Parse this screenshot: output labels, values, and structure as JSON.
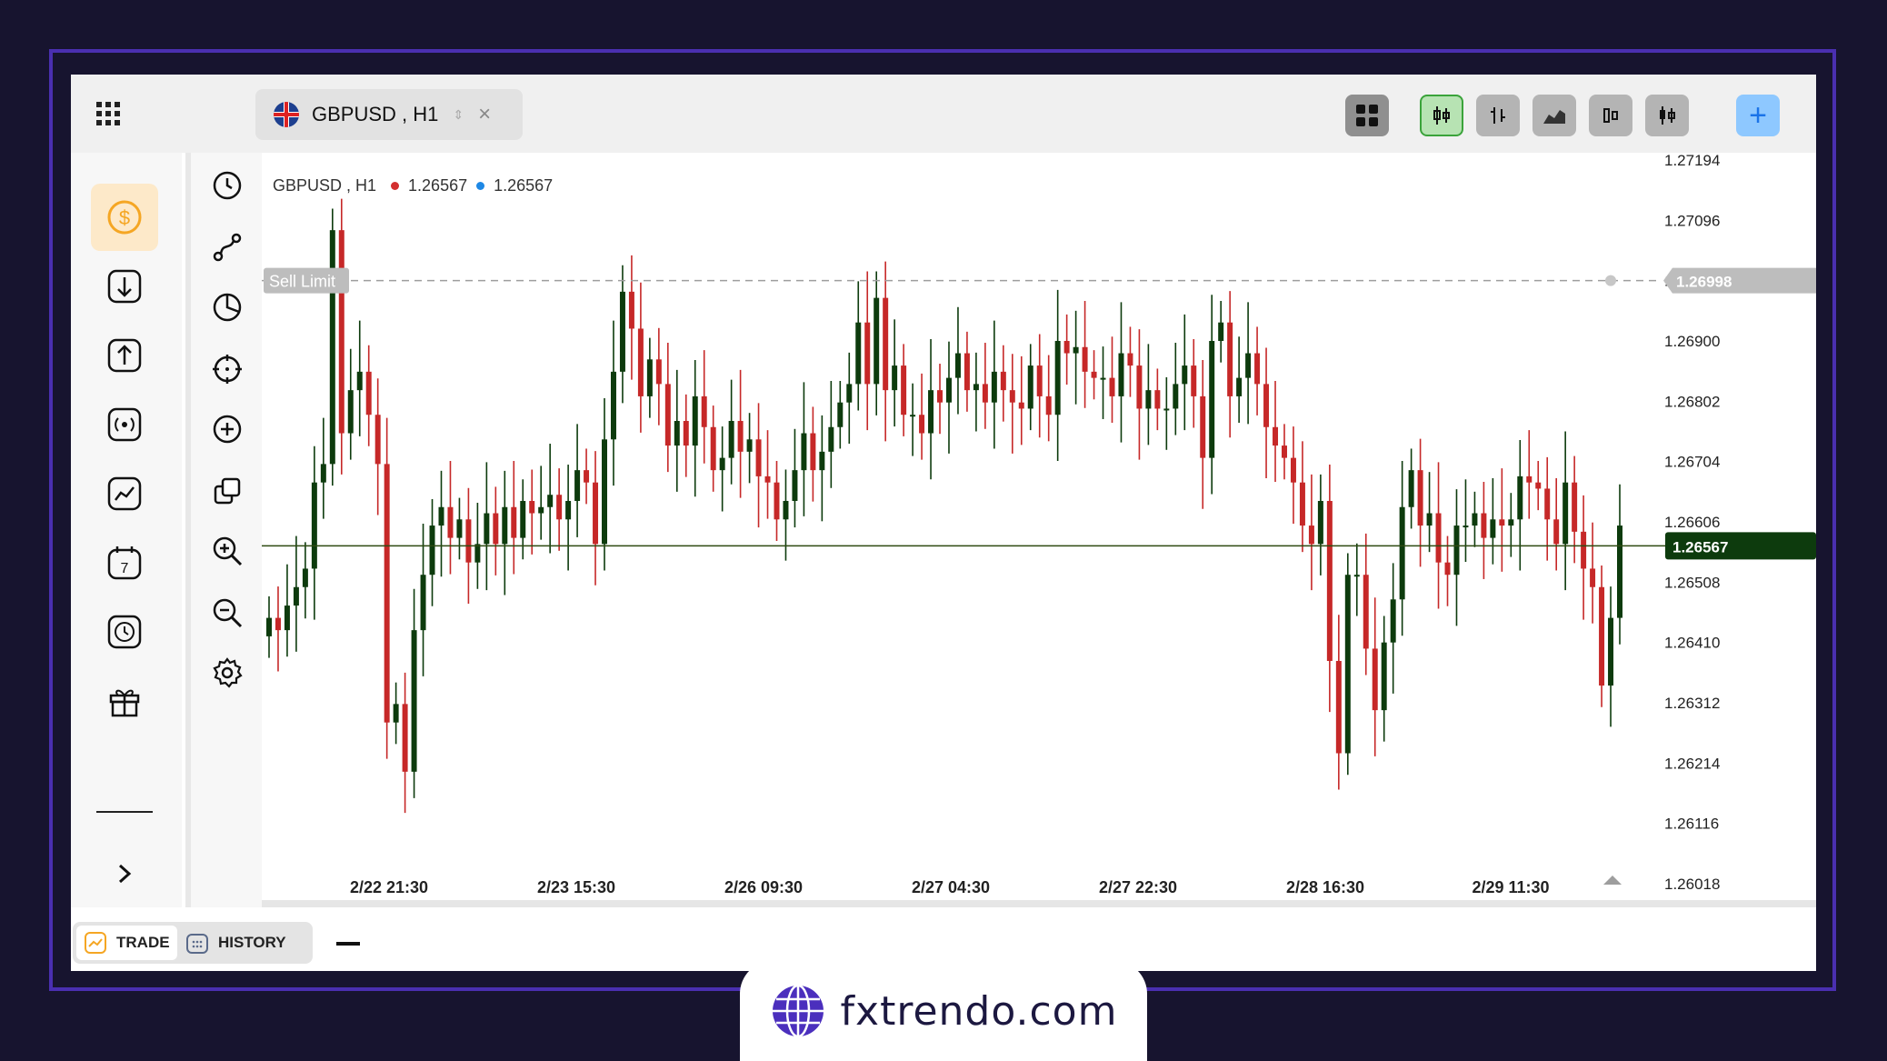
{
  "tab": {
    "title": "GBPUSD , H1",
    "flag_icon": "uk-flag-icon"
  },
  "chart_header": {
    "symbol": "GBPUSD , H1",
    "bid": "1.26567",
    "ask": "1.26567",
    "bid_color": "#d32f2f",
    "ask_color": "#1e88e5"
  },
  "order_line": {
    "label": "Sell Limit",
    "price": "1.26998"
  },
  "current_price": "1.26567",
  "bottom": {
    "trade_label": "TRADE",
    "history_label": "HISTORY"
  },
  "brand": {
    "text": "fxtrendo.com"
  },
  "colors": {
    "bull": "#0d3b0d",
    "bear": "#c62828",
    "accent_frame": "#4a2fb0",
    "background": "#17142f",
    "active_button": "#fde9c9"
  },
  "chart_data": {
    "type": "candlestick",
    "ylim": [
      1.26018,
      1.27194
    ],
    "y_ticks": [
      "1.27194",
      "1.27096",
      "1.26998",
      "1.26900",
      "1.26802",
      "1.26704",
      "1.26606",
      "1.26508",
      "1.26410",
      "1.26312",
      "1.26214",
      "1.26116",
      "1.26018"
    ],
    "x_ticks": [
      "2/22 21:30",
      "2/23 15:30",
      "2/26 09:30",
      "2/27 04:30",
      "2/27 22:30",
      "2/28 16:30",
      "2/29 11:30"
    ],
    "closes": [
      1.2645,
      1.2643,
      1.2647,
      1.265,
      1.2653,
      1.2667,
      1.267,
      1.2708,
      1.2675,
      1.2682,
      1.2685,
      1.2678,
      1.267,
      1.2628,
      1.2631,
      1.262,
      1.2643,
      1.2652,
      1.266,
      1.2663,
      1.2658,
      1.2661,
      1.2654,
      1.2657,
      1.2662,
      1.2657,
      1.2663,
      1.2658,
      1.2664,
      1.2662,
      1.2663,
      1.2665,
      1.2661,
      1.2664,
      1.2669,
      1.2667,
      1.2657,
      1.2674,
      1.2685,
      1.2698,
      1.2692,
      1.2681,
      1.2687,
      1.2683,
      1.2673,
      1.2677,
      1.2673,
      1.2681,
      1.2676,
      1.2669,
      1.2671,
      1.2677,
      1.2672,
      1.2674,
      1.2668,
      1.2667,
      1.2661,
      1.2664,
      1.2669,
      1.2675,
      1.2669,
      1.2672,
      1.2676,
      1.268,
      1.2683,
      1.2693,
      1.2683,
      1.2697,
      1.2682,
      1.2686,
      1.2678,
      1.2678,
      1.2675,
      1.2682,
      1.268,
      1.2684,
      1.2688,
      1.2682,
      1.2683,
      1.268,
      1.2685,
      1.2682,
      1.268,
      1.2679,
      1.2686,
      1.2681,
      1.2678,
      1.269,
      1.2688,
      1.2689,
      1.2685,
      1.2684,
      1.2684,
      1.2681,
      1.2688,
      1.2686,
      1.2679,
      1.2682,
      1.2679,
      1.2679,
      1.2683,
      1.2686,
      1.2681,
      1.2671,
      1.269,
      1.2693,
      1.2681,
      1.2684,
      1.2688,
      1.2683,
      1.2676,
      1.2673,
      1.2671,
      1.2667,
      1.266,
      1.2657,
      1.2664,
      1.2638,
      1.2623,
      1.2652,
      1.2652,
      1.264,
      1.263,
      1.2641,
      1.2648,
      1.2663,
      1.2669,
      1.266,
      1.2662,
      1.2654,
      1.2652,
      1.266,
      1.266,
      1.2662,
      1.2658,
      1.2661,
      1.266,
      1.2661,
      1.2668,
      1.2667,
      1.2666,
      1.2661,
      1.2657,
      1.2667,
      1.2659,
      1.2653,
      1.265,
      1.2634,
      1.2645,
      1.266
    ]
  }
}
